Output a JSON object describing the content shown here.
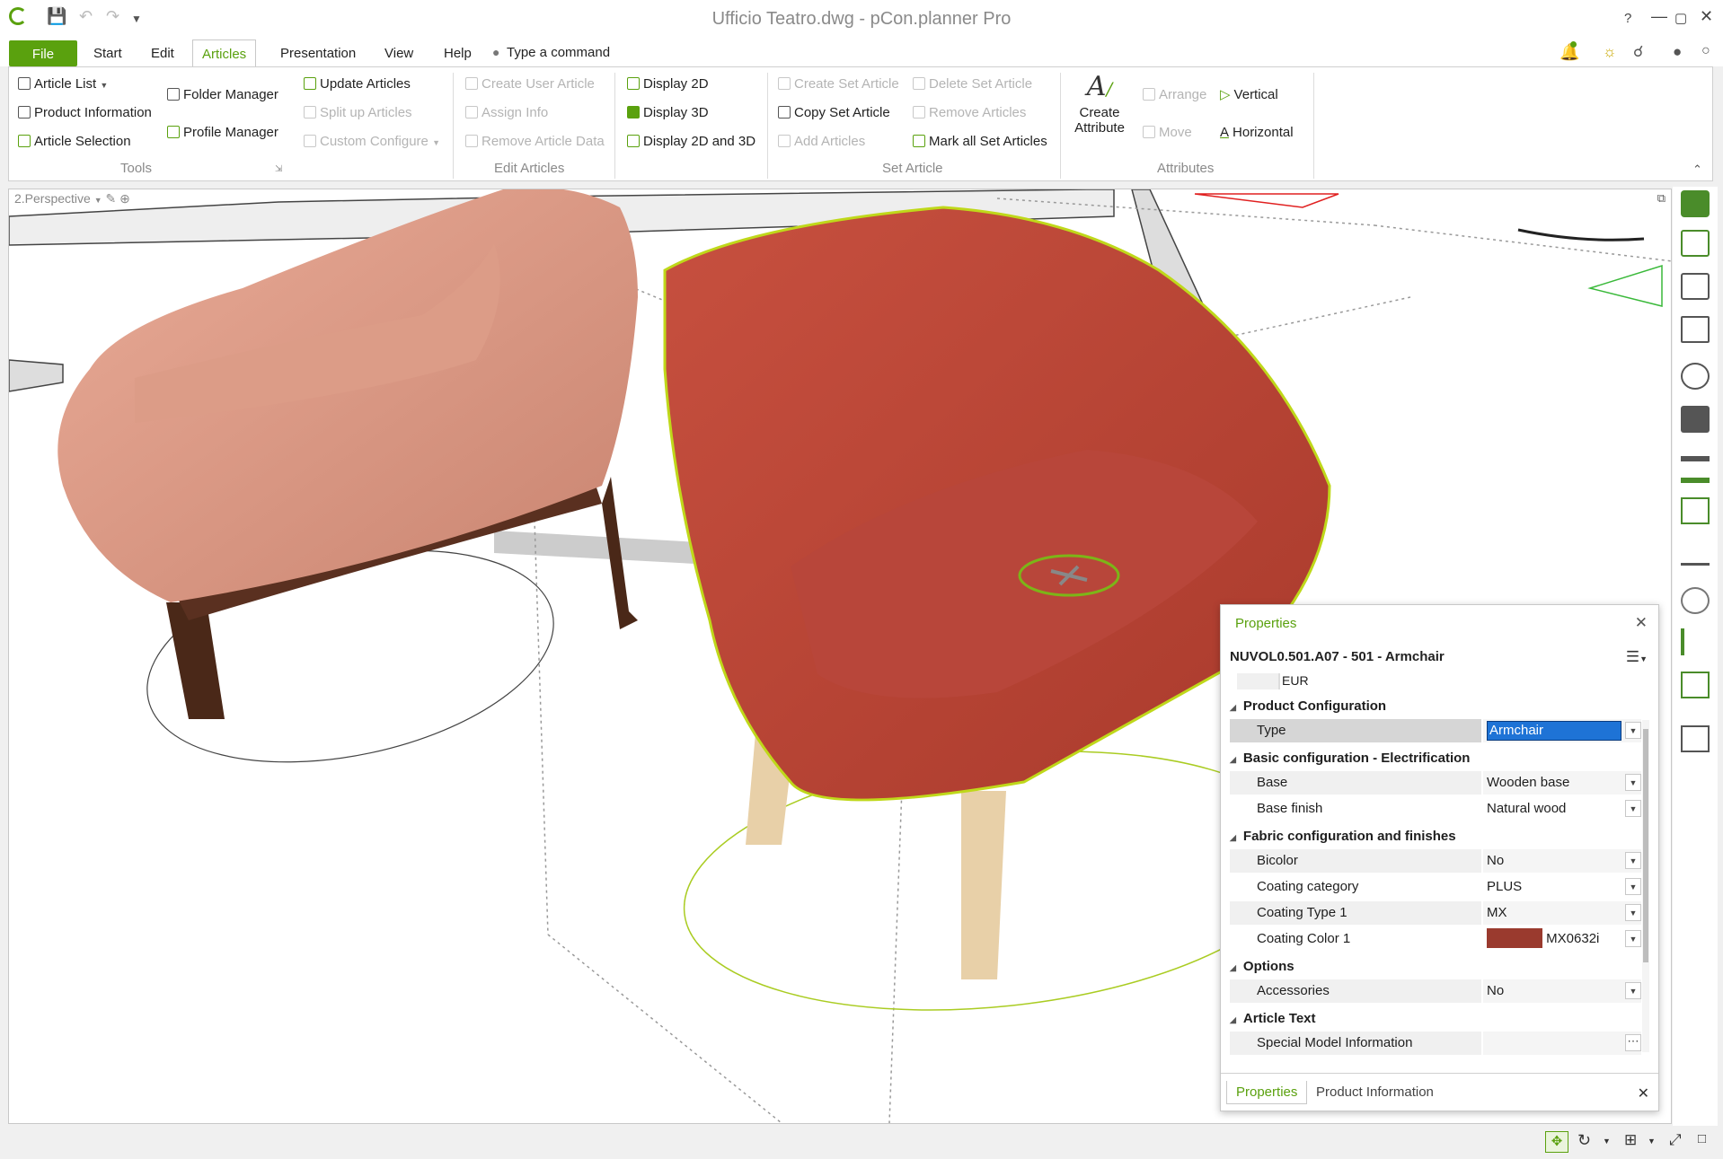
{
  "window": {
    "title": "Ufficio Teatro.dwg - pCon.planner Pro"
  },
  "menu": {
    "file": "File",
    "tabs": [
      "Start",
      "Edit",
      "Articles",
      "Presentation",
      "View",
      "Help"
    ],
    "command_placeholder": "Type a command"
  },
  "ribbon": {
    "tools": {
      "article_list": "Article List",
      "product_information": "Product Information",
      "article_selection": "Article Selection",
      "folder_manager": "Folder Manager",
      "profile_manager": "Profile Manager",
      "update_articles": "Update Articles",
      "split_up_articles": "Split up Articles",
      "custom_configure": "Custom Configure",
      "label": "Tools"
    },
    "edit_articles": {
      "create_user_article": "Create User Article",
      "assign_info": "Assign Info",
      "remove_article_data": "Remove Article Data",
      "display_2d": "Display 2D",
      "display_3d": "Display 3D",
      "display_2d_3d": "Display 2D and 3D",
      "label": "Edit Articles"
    },
    "set_article": {
      "create_set_article": "Create Set Article",
      "copy_set_article": "Copy Set Article",
      "add_articles": "Add Articles",
      "delete_set_article": "Delete Set Article",
      "remove_articles": "Remove Articles",
      "mark_all_set_articles": "Mark all Set Articles",
      "label": "Set Article"
    },
    "attributes": {
      "create_attribute_1": "Create",
      "create_attribute_2": "Attribute",
      "arrange": "Arrange",
      "move": "Move",
      "vertical": "Vertical",
      "horizontal": "Horizontal",
      "label": "Attributes"
    }
  },
  "viewport": {
    "label": "2.Perspective"
  },
  "properties": {
    "header": "Properties",
    "article": "NUVOL0.501.A07 - 501 - Armchair",
    "currency": "EUR",
    "sections": {
      "product_configuration": "Product Configuration",
      "basic_configuration": "Basic configuration - Electrification",
      "fabric_configuration": "Fabric configuration and finishes",
      "options": "Options",
      "article_text": "Article Text"
    },
    "rows": {
      "type": {
        "label": "Type",
        "value": "Armchair"
      },
      "base": {
        "label": "Base",
        "value": "Wooden base"
      },
      "base_finish": {
        "label": "Base finish",
        "value": "Natural wood"
      },
      "bicolor": {
        "label": "Bicolor",
        "value": "No"
      },
      "coating_category": {
        "label": "Coating category",
        "value": "PLUS"
      },
      "coating_type_1": {
        "label": "Coating Type 1",
        "value": "MX"
      },
      "coating_color_1": {
        "label": "Coating Color 1",
        "value": "MX0632i",
        "swatch": "#9a3a2e"
      },
      "accessories": {
        "label": "Accessories",
        "value": "No"
      },
      "special_model_information": {
        "label": "Special Model Information",
        "value": ""
      }
    },
    "tabs": [
      "Properties",
      "Product Information"
    ]
  },
  "colors": {
    "accent": "#5aa10e",
    "selection": "#1e73d6",
    "armchair_left": "#d9917c",
    "armchair_right": "#c04a3b"
  }
}
